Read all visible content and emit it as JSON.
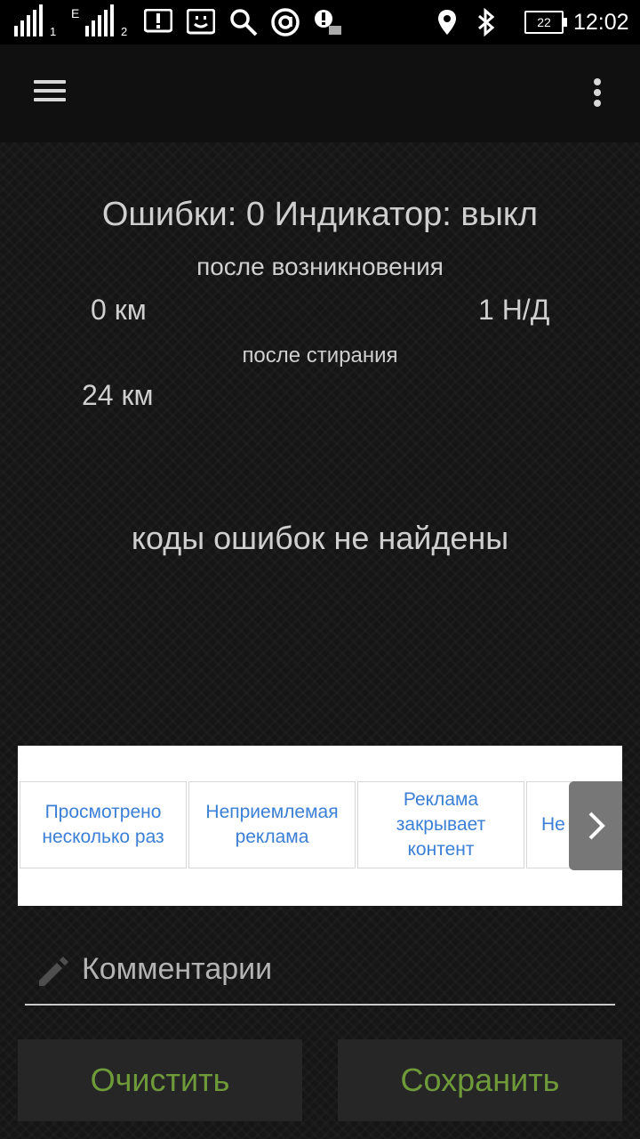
{
  "status_bar": {
    "sim1_label": "1",
    "sim2_net": "E",
    "sim2_label": "2",
    "battery": "22",
    "time": "12:02",
    "icons": [
      "signal-icon",
      "signal-icon",
      "alert-message-icon",
      "smiley-icon",
      "search-icon",
      "at-icon",
      "notification-icon",
      "location-icon",
      "bluetooth-icon",
      "battery-icon"
    ]
  },
  "toolbar": {
    "menu_icon": "hamburger-menu-icon",
    "more_icon": "more-vertical-icon"
  },
  "summary": {
    "headline": "Ошибки: 0 Индикатор: выкл",
    "after_occurrence_label": "после возникновения",
    "after_occurrence_km": "0 км",
    "after_occurrence_value": "1 Н/Д",
    "after_clear_label": "после стирания",
    "after_clear_km": "24 км"
  },
  "no_codes_message": "коды ошибок не найдены",
  "ad_feedback": {
    "options": [
      "Просмотрено несколько раз",
      "Неприемлемая реклама",
      "Реклама закрывает контент",
      "Не интересно"
    ]
  },
  "comment": {
    "placeholder": "Комментарии",
    "icon": "pencil-icon"
  },
  "buttons": {
    "clear": "Очистить",
    "save": "Сохранить"
  },
  "colors": {
    "accent_green": "#6f9a3a",
    "ad_link_blue": "#3b7fd6",
    "background": "#151515"
  }
}
